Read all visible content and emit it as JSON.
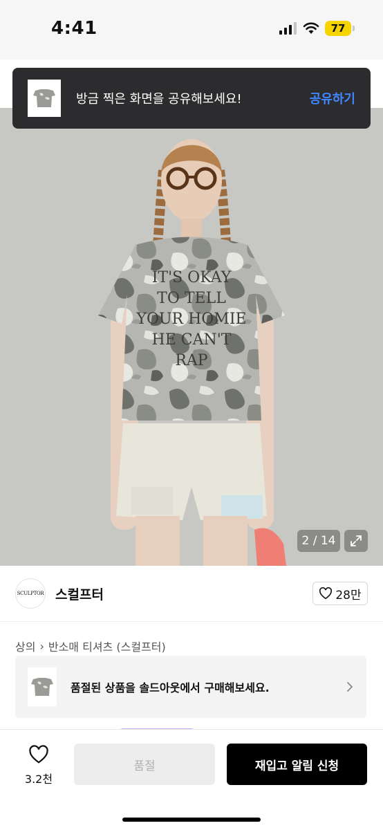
{
  "status_bar": {
    "time": "4:41",
    "battery": "77",
    "battery_color": "#f5d400"
  },
  "toast": {
    "message": "방금 찍은 화면을 공유해보세요!",
    "action": "공유하기",
    "action_color": "#3f87ff"
  },
  "gallery": {
    "counter": "2 / 14",
    "expand_icon": "expand-icon"
  },
  "shirt_print": {
    "lines": [
      "IT'S OKAY",
      "TO TELL",
      "YOUR HOMIE",
      "HE CAN'T",
      "RAP"
    ]
  },
  "brand": {
    "logo_text": "SCULPTOR",
    "name": "스컬프터",
    "likes": "28만"
  },
  "breadcrumb": {
    "category": "상의",
    "separator": "›",
    "subcategory": "반소매 티셔츠 (스컬프터)"
  },
  "soldout_banner": {
    "text": "품절된 상품을 솔드아웃에서 구매해보세요."
  },
  "bottom_bar": {
    "wish_count": "3.2천",
    "soldout_label": "품절",
    "restock_label": "재입고 알림 신청"
  }
}
